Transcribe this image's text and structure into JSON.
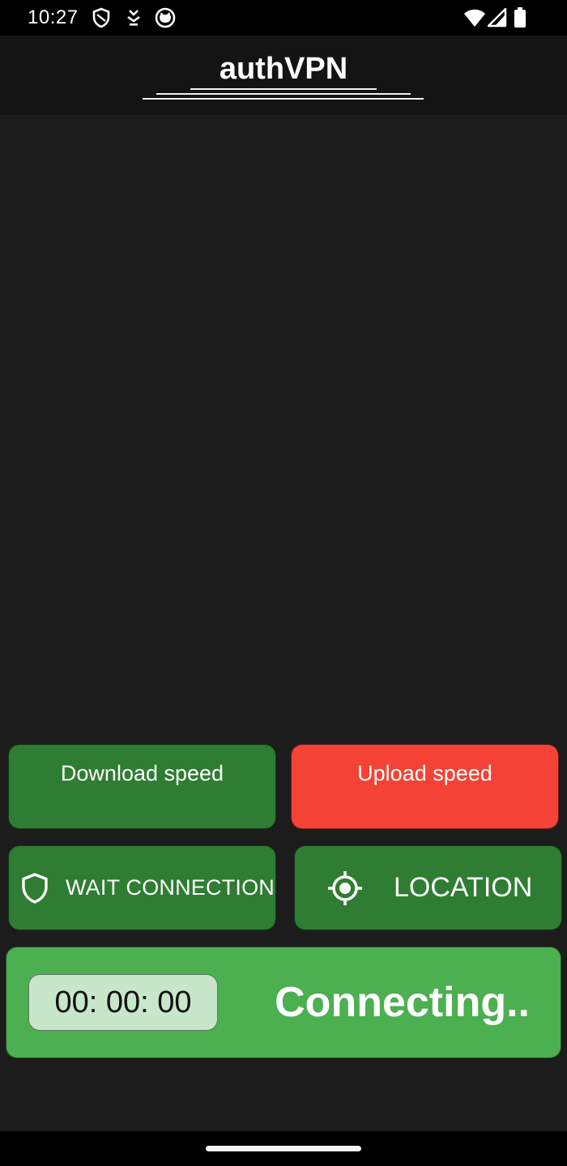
{
  "status_bar": {
    "time": "10:27",
    "icons": [
      "shield-outline-icon",
      "download-arrow-icon",
      "cat-face-icon",
      "wifi-icon",
      "signal-icon",
      "battery-icon"
    ]
  },
  "app_bar": {
    "title": "authVPN"
  },
  "speed": {
    "download_label": "Download speed",
    "upload_label": "Upload speed"
  },
  "actions": {
    "wait_label": "WAIT CONNECTION",
    "location_label": "LOCATION"
  },
  "connection": {
    "timer": "00: 00: 00",
    "status": "Connecting.."
  },
  "colors": {
    "dark_green": "#2e7d32",
    "red": "#f44336",
    "green": "#4caf50",
    "timer_bg": "#c8e6c9",
    "background": "#1c1c1c"
  }
}
